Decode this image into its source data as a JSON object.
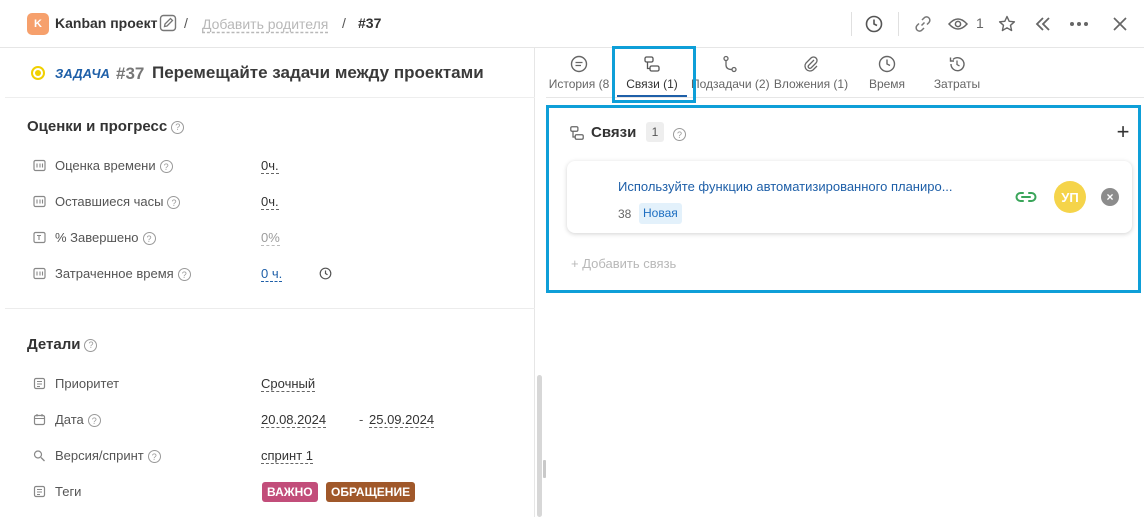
{
  "header": {
    "project_initial": "K",
    "project_name": "Kanban проект",
    "separator": "/",
    "add_parent": "Добавить родителя",
    "task_number": "#37",
    "watchers_count": "1"
  },
  "task": {
    "type": "ЗАДАЧА",
    "id": "#37",
    "title": "Перемещайте задачи между проектами"
  },
  "estimates": {
    "title": "Оценки и прогресс",
    "help": "?",
    "fields": [
      {
        "label": "Оценка времени",
        "help": "?",
        "value": "0ч."
      },
      {
        "label": "Оставшиеся часы",
        "help": "?",
        "value": "0ч."
      },
      {
        "label": "% Завершено",
        "help": "?",
        "value": "0%"
      },
      {
        "label": "Затраченное время",
        "help": "?",
        "value": "0 ч."
      }
    ]
  },
  "details": {
    "title": "Детали",
    "help": "?",
    "priority_label": "Приоритет",
    "priority_value": "Срочный",
    "date_label": "Дата",
    "date_help": "?",
    "date_start": "20.08.2024",
    "date_sep": "-",
    "date_end": "25.09.2024",
    "version_label": "Версия/спринт",
    "version_help": "?",
    "version_value": "спринт 1",
    "tags_label": "Теги",
    "tags": [
      {
        "label": "ВАЖНО",
        "color": "#c24d7a"
      },
      {
        "label": "ОБРАЩЕНИЕ",
        "color": "#a0582a"
      }
    ]
  },
  "tabs": [
    {
      "label": "История (8",
      "icon": "history-icon"
    },
    {
      "label": "Связи (1)",
      "icon": "links-icon"
    },
    {
      "label": "Подзадачи (2)",
      "icon": "subtasks-icon"
    },
    {
      "label": "Вложения (1)",
      "icon": "attachment-icon"
    },
    {
      "label": "Время",
      "icon": "clock-icon"
    },
    {
      "label": "Затраты",
      "icon": "costs-icon"
    }
  ],
  "links": {
    "title": "Связи",
    "count": "1",
    "help": "?",
    "add_icon": "+",
    "items": [
      {
        "title": "Используйте функцию автоматизированного планиро...",
        "number": "38",
        "status": "Новая",
        "avatar": "УП",
        "remove": "×"
      }
    ],
    "add_link": "+ Добавить связь"
  },
  "colors": {
    "accent": "#1e5fa8",
    "highlight": "#0e9fd8",
    "project_badge": "#f6a06c",
    "avatar": "#f5d44a",
    "link_green": "#3aa55a"
  }
}
